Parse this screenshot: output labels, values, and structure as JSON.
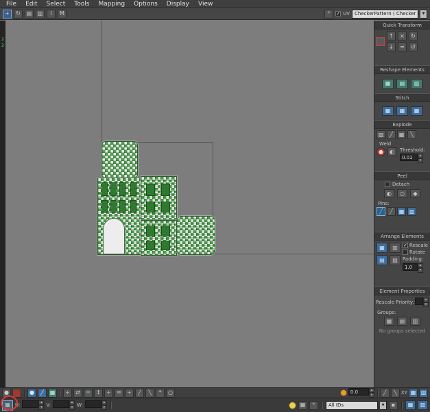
{
  "menu": {
    "items": [
      "File",
      "Edit",
      "Select",
      "Tools",
      "Mapping",
      "Options",
      "Display",
      "View"
    ]
  },
  "toolbar": {
    "uv_label": "UV",
    "pattern_value": "CheckerPattern ( Checker )"
  },
  "viewport_stats": [
    "2",
    "2"
  ],
  "panel": {
    "quick_transform": {
      "title": "Quick Transform"
    },
    "reshape": {
      "title": "Reshape Elements"
    },
    "stitch": {
      "title": "Stitch"
    },
    "explode": {
      "title": "Explode",
      "weld_label": "Weld",
      "threshold_label": "Threshold:",
      "threshold_value": "0.01"
    },
    "peel": {
      "title": "Peel",
      "detach_label": "Detach",
      "pins_label": "Pins:"
    },
    "arrange": {
      "title": "Arrange Elements",
      "rescale_label": "Rescale",
      "rotate_label": "Rotate",
      "padding_label": "Padding:",
      "padding_value": "1.0"
    },
    "element_properties": {
      "title": "Element Properties",
      "rescale_priority_label": "Rescale Priority:",
      "groups_label": "Groups:",
      "no_groups_text": "No groups selected"
    }
  },
  "bottom": {
    "u_label": "U:",
    "v_label": "V:",
    "w_label": "W:",
    "u_value": "",
    "v_value": "",
    "w_value": "",
    "angle_value": "0.0",
    "xy_label": "XY",
    "all_ids_value": "All IDs"
  },
  "colors": {
    "checker_green": "#4aa04a",
    "accent_blue": "#3c6e9f",
    "annotation_red": "#e03a2f"
  },
  "glyphs": {
    "plus": "+",
    "cross": "×",
    "rotate_cw": "↻",
    "rotate_ccw": "↺",
    "arrow_up": "↑",
    "arrow_down": "↓",
    "arrows_lr": "⇄",
    "arrows_ud": "↕",
    "equals": "═",
    "grid": "▦",
    "grid_col": "▥",
    "grid_row": "▤",
    "grid_diag": "▧",
    "slash": "╱",
    "backslash": "╲",
    "dot": "●",
    "circle": "○",
    "half_circle": "◐",
    "diamond": "◆",
    "star": "*",
    "check": "✓",
    "tri_down": "▼",
    "tri_up": "▴",
    "tri_dn": "▾",
    "square": "▪",
    "i": "I",
    "m": "M"
  }
}
